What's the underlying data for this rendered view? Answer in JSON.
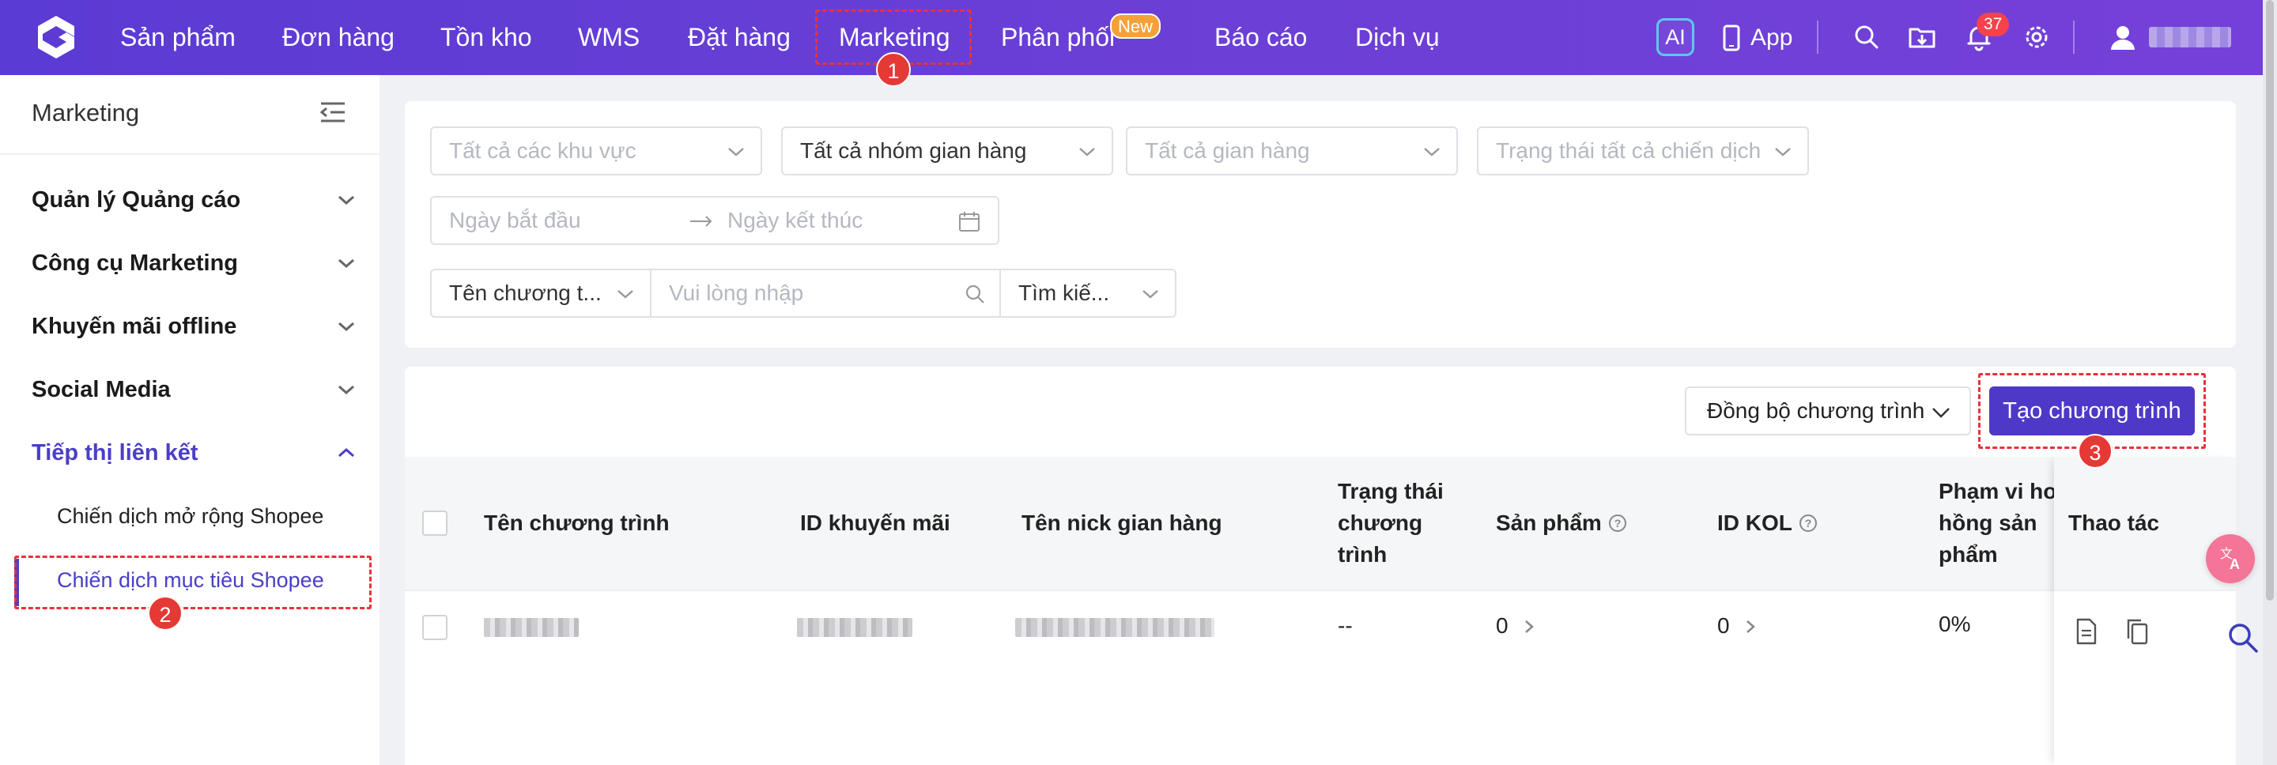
{
  "topbar": {
    "nav": [
      {
        "label": "Sản phẩm"
      },
      {
        "label": "Đơn hàng"
      },
      {
        "label": "Tồn kho"
      },
      {
        "label": "WMS"
      },
      {
        "label": "Đặt hàng"
      },
      {
        "label": "Marketing"
      },
      {
        "label": "Phân phối"
      },
      {
        "label": "Báo cáo"
      },
      {
        "label": "Dịch vụ"
      }
    ],
    "new_badge": "New",
    "ai_label": "AI",
    "app_label": "App",
    "notification_count": "37",
    "icons": [
      "logo-icon",
      "phone-icon",
      "search-icon",
      "folder-download-icon",
      "bell-icon",
      "gear-icon",
      "user-icon"
    ]
  },
  "annotations": {
    "step1": "1",
    "step2": "2",
    "step3": "3",
    "highlight_color": "#e8323c"
  },
  "sidebar": {
    "title": "Marketing",
    "groups": [
      {
        "label": "Quản lý Quảng cáo",
        "expanded": false
      },
      {
        "label": "Công cụ Marketing",
        "expanded": false
      },
      {
        "label": "Khuyến mãi offline",
        "expanded": false
      },
      {
        "label": "Social Media",
        "expanded": false
      },
      {
        "label": "Tiếp thị liên kết",
        "expanded": true,
        "active": true
      }
    ],
    "sub_items": [
      {
        "label": "Chiến dịch mở rộng Shopee"
      },
      {
        "label": "Chiến dịch mục tiêu Shopee",
        "active": true
      }
    ]
  },
  "filters": {
    "region": "Tất cả các khu vực",
    "store_group": "Tất cả nhóm gian hàng",
    "store": "Tất cả gian hàng",
    "campaign_status": "Trạng thái tất cả chiến dịch",
    "start_date_placeholder": "Ngày bắt đầu",
    "end_date_placeholder": "Ngày kết thúc",
    "search_field": "Tên chương t...",
    "search_placeholder": "Vui lòng nhập",
    "search_mode": "Tìm kiế..."
  },
  "toolbar": {
    "sync_label": "Đồng bộ chương trình",
    "create_label": "Tạo chương trình"
  },
  "table": {
    "columns": [
      "Tên chương trình",
      "ID khuyến mãi",
      "Tên nick gian hàng",
      "Trạng thái chương trình",
      "Sản phẩm",
      "ID KOL",
      "Phạm vi hoa hồng sản phẩm",
      "Thao tác"
    ],
    "col_status_lines": [
      "Trạng thái",
      "chương",
      "trình"
    ],
    "col_scope_lines": [
      "Phạm vi ho",
      "hồng sản",
      "phẩm"
    ],
    "rows": [
      {
        "name": "(blurred)",
        "promo_id": "(blurred)",
        "store_nick": "(blurred)",
        "status": "--",
        "products": "0",
        "kol_id": "0",
        "commission_scope": "0%"
      }
    ]
  },
  "colors": {
    "brand": "#5a3bd3",
    "primary_button": "#4e38c8",
    "active_text": "#4a3fc6",
    "badge_red": "#f5424d",
    "new_badge": "#f4a13a"
  }
}
